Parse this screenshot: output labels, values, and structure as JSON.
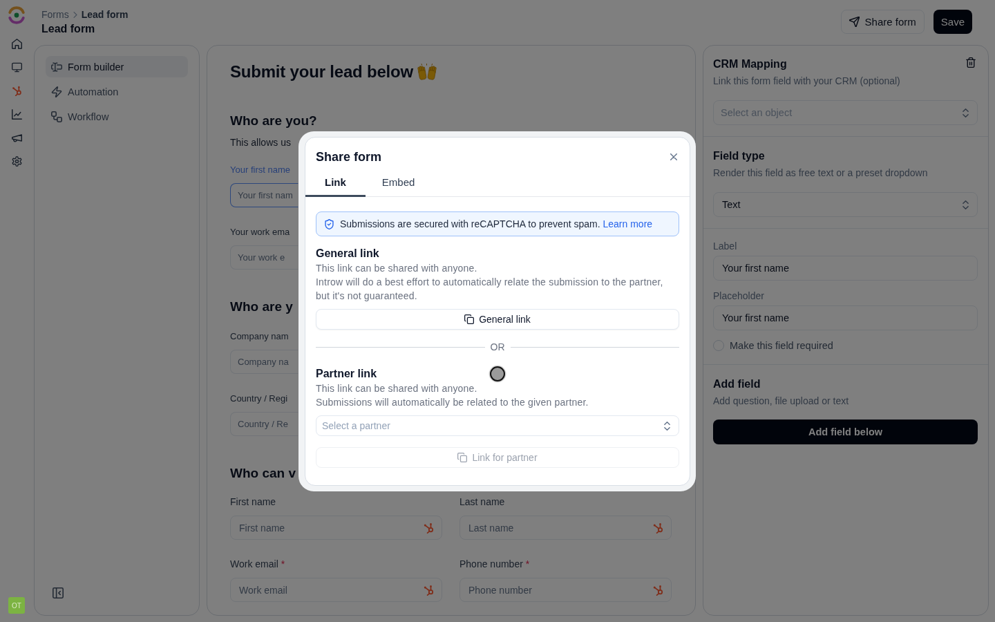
{
  "rail": {
    "items": [
      {
        "kind": "home"
      },
      {
        "kind": "monitor"
      },
      {
        "kind": "sprocket"
      },
      {
        "kind": "chart"
      },
      {
        "kind": "megaphone"
      },
      {
        "kind": "settings"
      }
    ],
    "avatar": "OT"
  },
  "header": {
    "breadcrumb": [
      "Forms",
      "Lead form"
    ],
    "title": "Lead form",
    "actions": [
      {
        "label": "Share form",
        "kind": "outline"
      },
      {
        "label": "Save",
        "kind": "primary"
      }
    ]
  },
  "nav": {
    "items": [
      {
        "label": "Form builder",
        "kind": "builder",
        "selected": true
      },
      {
        "label": "Automation",
        "kind": "automation",
        "selected": false
      },
      {
        "label": "Workflow",
        "kind": "workflow",
        "selected": false
      }
    ]
  },
  "form": {
    "title": "Submit your lead below",
    "sections": [
      {
        "kind": "stack",
        "heading": "Who are you?",
        "description": "This allows us",
        "fields": [
          {
            "label": "Your first name",
            "placeholder": "Your first nam",
            "selected": true
          },
          {
            "label": "Your work ema",
            "placeholder": "Your work e",
            "selected": false
          }
        ]
      },
      {
        "kind": "stack",
        "heading": "Who are y",
        "fields": [
          {
            "label": "Company nam",
            "placeholder": "Company na",
            "selected": false
          },
          {
            "label": "Country / Regi",
            "placeholder": "Country / Re",
            "selected": false
          }
        ]
      },
      {
        "kind": "grid",
        "heading": "Who can v",
        "fields": [
          {
            "label": "First name",
            "placeholder": "First name",
            "selected": false,
            "crm_linked": true
          },
          {
            "label": "Last name",
            "placeholder": "Last name",
            "selected": false,
            "crm_linked": true
          },
          {
            "label": "Work email",
            "required_mark": "*",
            "placeholder": "Work email",
            "selected": false,
            "crm_linked": true
          },
          {
            "label": "Phone number",
            "required_mark": "*",
            "placeholder": "Phone number",
            "selected": false,
            "crm_linked": true
          }
        ]
      }
    ]
  },
  "properties": {
    "crm_mapping": {
      "title": "CRM Mapping",
      "description": "Link this form field with your CRM (optional)",
      "select": {
        "placeholder": "Select an object"
      }
    },
    "field_type": {
      "title": "Field type",
      "description": "Render this field as free text or a preset dropdown",
      "select": {
        "value": "Text"
      }
    },
    "field_settings": {
      "label": {
        "label": "Label",
        "value": "Your first name"
      },
      "placeholder": {
        "label": "Placeholder",
        "value": "Your first name"
      },
      "required": {
        "label": "Make this field required",
        "checked": false
      }
    },
    "add_field": {
      "title": "Add field",
      "description": "Add question, file upload or text",
      "button": "Add field below"
    }
  },
  "dialog": {
    "title": "Share form",
    "tabs": [
      {
        "label": "Link",
        "selected": true
      },
      {
        "label": "Embed",
        "selected": false
      }
    ],
    "notice": {
      "text": "Submissions are secured with reCAPTCHA to prevent spam.",
      "link": "Learn more"
    },
    "divider": "OR",
    "sections": [
      {
        "title": "General link",
        "description": [
          "This link can be shared with anyone.",
          "Introw will do a best effort to automatically relate the submission to the partner, but it's not guaranteed."
        ],
        "button": {
          "label": "General link",
          "disabled": false
        }
      },
      {
        "title": "Partner link",
        "description": [
          "This link can be shared with anyone.",
          "Submissions will automatically be related to the given partner."
        ],
        "select": {
          "placeholder": "Select a partner"
        },
        "button": {
          "label": "Link for partner",
          "disabled": true
        }
      }
    ]
  }
}
